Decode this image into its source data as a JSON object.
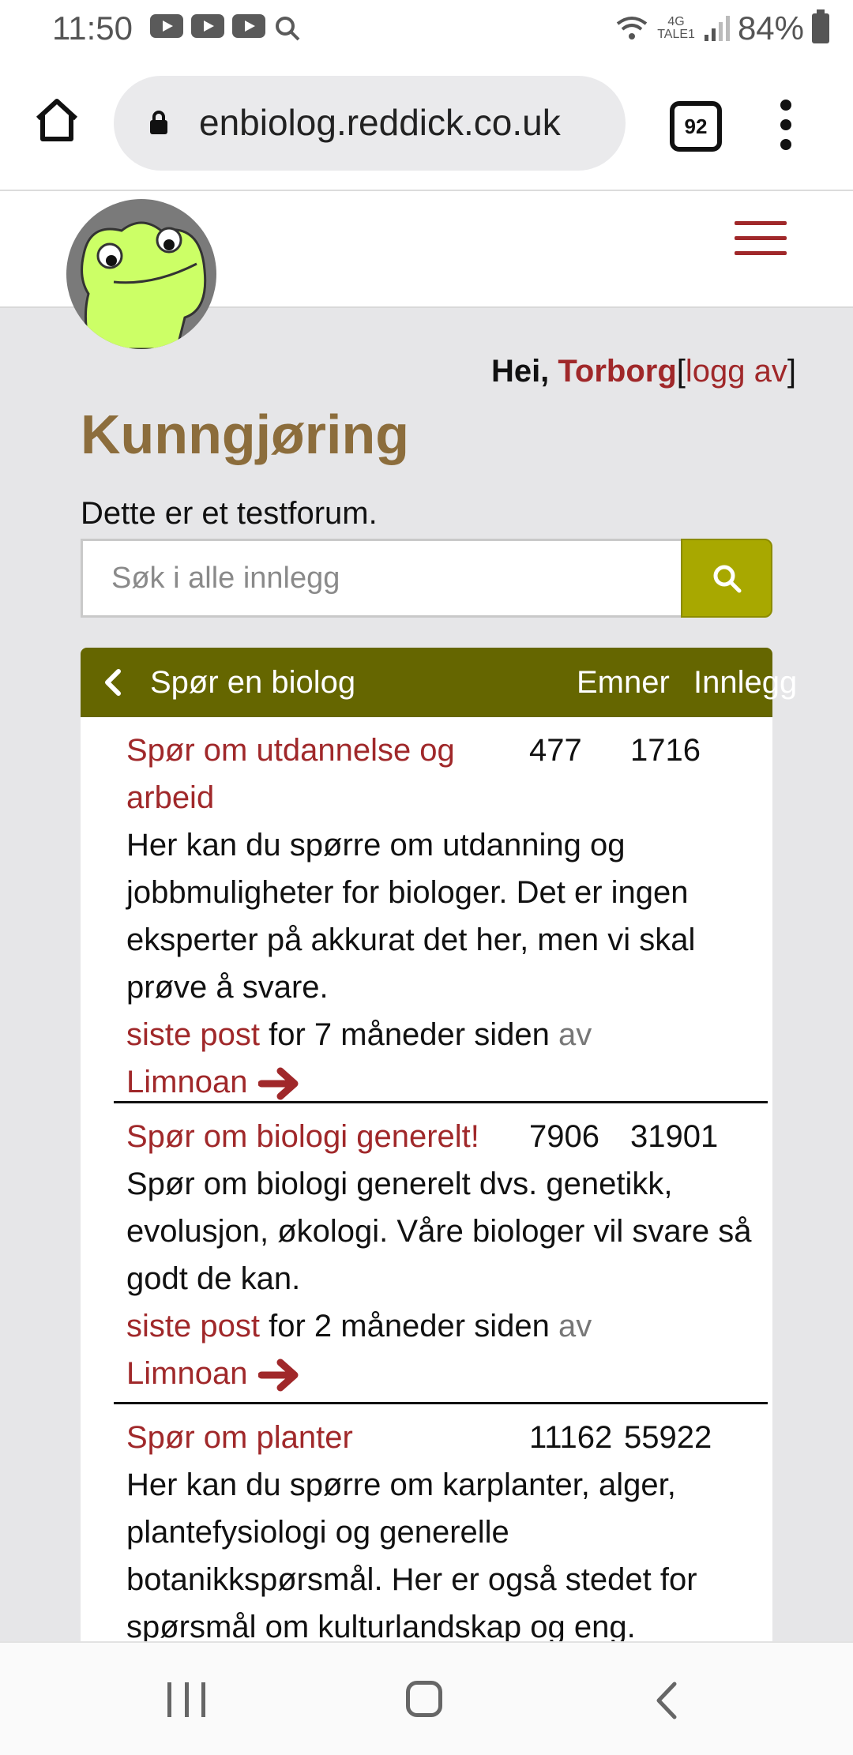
{
  "status": {
    "time": "11:50",
    "network_top": "4G",
    "network_bottom": "TALE1",
    "battery": "84%"
  },
  "browser": {
    "url": "enbiolog.reddick.co.uk",
    "tab_count": "92"
  },
  "user": {
    "greeting": "Hei,",
    "name": "Torborg",
    "logout": "logg av",
    "bracket_open": "[",
    "bracket_close": "]"
  },
  "page": {
    "title": "Kunngjøring",
    "description": "Dette er et testforum."
  },
  "search": {
    "placeholder": "Søk i alle innlegg"
  },
  "forum_header": {
    "name": "Spør en biolog",
    "col_topics": "Emner",
    "col_posts": "Innlegg"
  },
  "forums": [
    {
      "name": "Spør om utdannelse og arbeid",
      "topics": "477",
      "posts": "1716",
      "description": "Her kan du spørre om utdanning og jobbmuligheter for biologer. Det er ingen eksperter på akkurat det her, men vi skal prøve å svare.",
      "last_post_label": "siste post",
      "last_post_time": "for 7 måneder siden",
      "by": "av",
      "author": "Limnoan"
    },
    {
      "name": "Spør om biologi generelt!",
      "topics": "7906",
      "posts": "31901",
      "description": "Spør om biologi generelt dvs. genetikk, evolusjon, økologi. Våre biologer vil svare så godt de kan.",
      "last_post_label": "siste post",
      "last_post_time": "for 2 måneder siden",
      "by": "av",
      "author": "Limnoan"
    },
    {
      "name": "Spør om planter",
      "topics": "11162",
      "posts": "55922",
      "description": "Her kan du spørre om karplanter, alger, plantefysiologi og generelle botanikkspørsmål. Her er også stedet for spørsmål om kulturlandskap og eng."
    }
  ],
  "colors": {
    "accent_red": "#a0282a",
    "title_brown": "#8c6d3c",
    "header_olive": "#656600",
    "search_button": "#a8a800"
  },
  "icons": [
    "home-icon",
    "lock-icon",
    "tabs-icon",
    "more-vert-icon",
    "hamburger-menu-icon",
    "search-icon",
    "chevron-left-icon",
    "arrow-right-icon"
  ]
}
